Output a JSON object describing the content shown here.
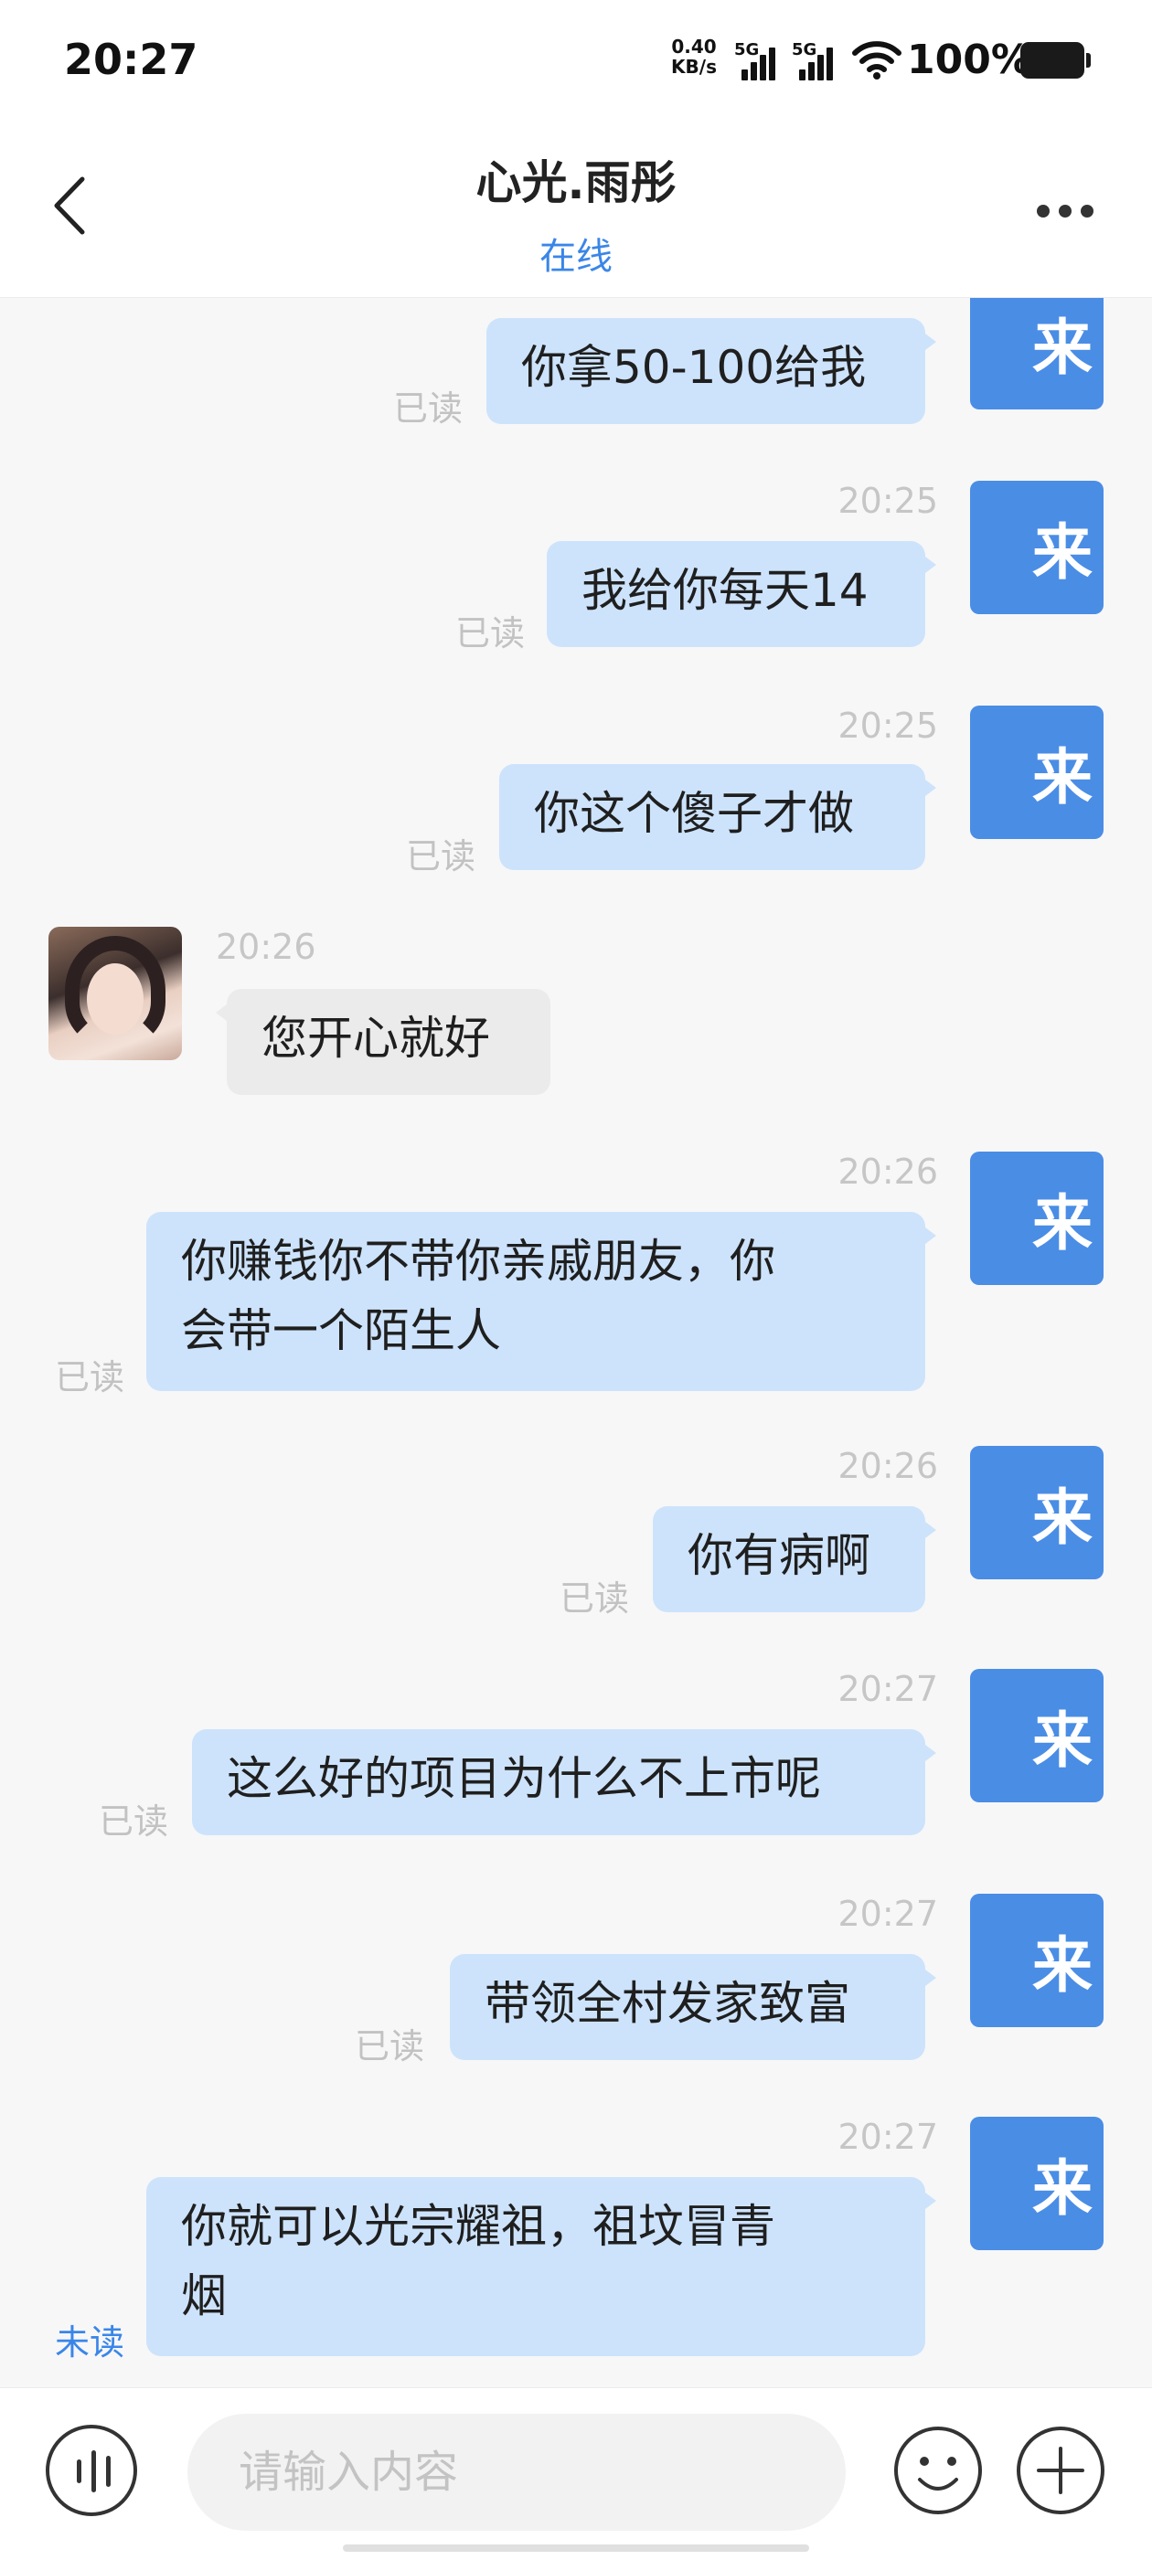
{
  "status_bar": {
    "time": "20:27",
    "net_speed_value": "0.40",
    "net_speed_unit": "KB/s",
    "signal_1": "5G",
    "signal_2": "5G",
    "battery": "100%",
    "icons": [
      "signal-icon",
      "wifi-icon",
      "battery-icon"
    ]
  },
  "header": {
    "title": "心光.雨彤",
    "subtitle": "在线",
    "icons": [
      "back-icon",
      "more-icon"
    ]
  },
  "colors": {
    "accent": "#3a86e8",
    "my_bubble": "#cde3fb",
    "other_bubble": "#ebebeb",
    "my_avatar": "#4a8de5",
    "background": "#f7f7f8"
  },
  "my_avatar_text": "来",
  "messages": [
    {
      "sender": "me",
      "time": "",
      "lines": [
        "你拿50-100给我"
      ],
      "status": "已读"
    },
    {
      "sender": "me",
      "time": "20:25",
      "lines": [
        "我给你每天14"
      ],
      "status": "已读"
    },
    {
      "sender": "me",
      "time": "20:25",
      "lines": [
        "你这个傻子才做"
      ],
      "status": "已读"
    },
    {
      "sender": "other",
      "time": "20:26",
      "lines": [
        "您开心就好"
      ],
      "status": ""
    },
    {
      "sender": "me",
      "time": "20:26",
      "lines": [
        "你赚钱你不带你亲戚朋友，你",
        "会带一个陌生人"
      ],
      "status": "已读"
    },
    {
      "sender": "me",
      "time": "20:26",
      "lines": [
        "你有病啊"
      ],
      "status": "已读"
    },
    {
      "sender": "me",
      "time": "20:27",
      "lines": [
        "这么好的项目为什么不上市呢"
      ],
      "status": "已读"
    },
    {
      "sender": "me",
      "time": "20:27",
      "lines": [
        "带领全村发家致富"
      ],
      "status": "已读"
    },
    {
      "sender": "me",
      "time": "20:27",
      "lines": [
        "你就可以光宗耀祖，祖坟冒青",
        "烟"
      ],
      "status": "未读"
    }
  ],
  "input_bar": {
    "placeholder": "请输入内容",
    "value": "",
    "icons": [
      "voice-icon",
      "emoji-icon",
      "plus-icon"
    ]
  }
}
